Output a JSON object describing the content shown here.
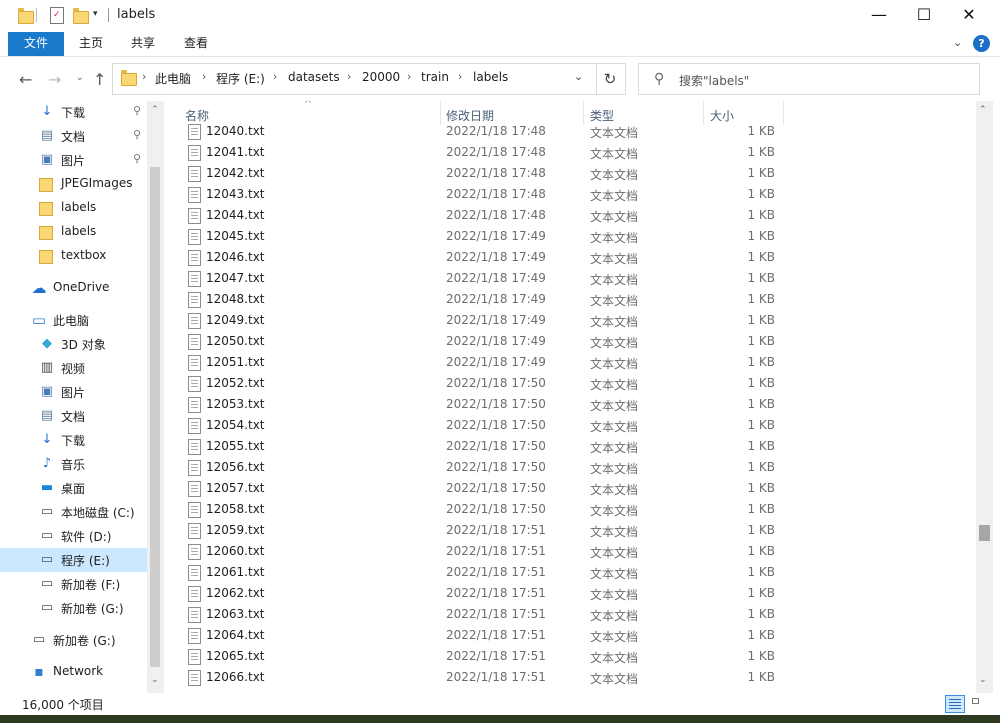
{
  "window": {
    "title": "labels",
    "controls": {
      "minimize": "—",
      "maximize": "☐",
      "close": "✕"
    }
  },
  "ribbon": {
    "tabs": [
      "文件",
      "主页",
      "共享",
      "查看"
    ],
    "help": "?"
  },
  "address": {
    "breadcrumbs": [
      "此电脑",
      "程序 (E:)",
      "datasets",
      "20000",
      "train",
      "labels"
    ]
  },
  "search": {
    "placeholder": "搜索\"labels\""
  },
  "sidebar": {
    "quick_access": [
      {
        "label": "下载",
        "icon": "download-icon",
        "pinned": true
      },
      {
        "label": "文档",
        "icon": "document-icon",
        "pinned": true
      },
      {
        "label": "图片",
        "icon": "pictures-icon",
        "pinned": true
      },
      {
        "label": "JPEGImages",
        "icon": "folder-icon",
        "pinned": false
      },
      {
        "label": "labels",
        "icon": "folder-icon",
        "pinned": false
      },
      {
        "label": "labels",
        "icon": "folder-icon",
        "pinned": false
      },
      {
        "label": "textbox",
        "icon": "folder-icon",
        "pinned": false
      }
    ],
    "onedrive": "OneDrive",
    "this_pc": "此电脑",
    "pc_items": [
      {
        "label": "3D 对象",
        "icon": "3d-objects-icon"
      },
      {
        "label": "视频",
        "icon": "video-icon"
      },
      {
        "label": "图片",
        "icon": "pictures-icon"
      },
      {
        "label": "文档",
        "icon": "document-icon"
      },
      {
        "label": "下载",
        "icon": "download-icon"
      },
      {
        "label": "音乐",
        "icon": "music-icon"
      },
      {
        "label": "桌面",
        "icon": "desktop-icon"
      },
      {
        "label": "本地磁盘 (C:)",
        "icon": "system-drive-icon"
      },
      {
        "label": "软件 (D:)",
        "icon": "drive-icon"
      },
      {
        "label": "程序 (E:)",
        "icon": "drive-icon",
        "selected": true
      },
      {
        "label": "新加卷 (F:)",
        "icon": "drive-icon"
      },
      {
        "label": "新加卷 (G:)",
        "icon": "drive-icon"
      }
    ],
    "removable": "新加卷 (G:)",
    "network": "Network"
  },
  "columns": {
    "name": "名称",
    "date": "修改日期",
    "type": "类型",
    "size": "大小"
  },
  "files": [
    {
      "name": "12040.txt",
      "date": "2022/1/18 17:48",
      "type": "文本文档",
      "size": "1 KB"
    },
    {
      "name": "12041.txt",
      "date": "2022/1/18 17:48",
      "type": "文本文档",
      "size": "1 KB"
    },
    {
      "name": "12042.txt",
      "date": "2022/1/18 17:48",
      "type": "文本文档",
      "size": "1 KB"
    },
    {
      "name": "12043.txt",
      "date": "2022/1/18 17:48",
      "type": "文本文档",
      "size": "1 KB"
    },
    {
      "name": "12044.txt",
      "date": "2022/1/18 17:48",
      "type": "文本文档",
      "size": "1 KB"
    },
    {
      "name": "12045.txt",
      "date": "2022/1/18 17:49",
      "type": "文本文档",
      "size": "1 KB"
    },
    {
      "name": "12046.txt",
      "date": "2022/1/18 17:49",
      "type": "文本文档",
      "size": "1 KB"
    },
    {
      "name": "12047.txt",
      "date": "2022/1/18 17:49",
      "type": "文本文档",
      "size": "1 KB"
    },
    {
      "name": "12048.txt",
      "date": "2022/1/18 17:49",
      "type": "文本文档",
      "size": "1 KB"
    },
    {
      "name": "12049.txt",
      "date": "2022/1/18 17:49",
      "type": "文本文档",
      "size": "1 KB"
    },
    {
      "name": "12050.txt",
      "date": "2022/1/18 17:49",
      "type": "文本文档",
      "size": "1 KB"
    },
    {
      "name": "12051.txt",
      "date": "2022/1/18 17:49",
      "type": "文本文档",
      "size": "1 KB"
    },
    {
      "name": "12052.txt",
      "date": "2022/1/18 17:50",
      "type": "文本文档",
      "size": "1 KB"
    },
    {
      "name": "12053.txt",
      "date": "2022/1/18 17:50",
      "type": "文本文档",
      "size": "1 KB"
    },
    {
      "name": "12054.txt",
      "date": "2022/1/18 17:50",
      "type": "文本文档",
      "size": "1 KB"
    },
    {
      "name": "12055.txt",
      "date": "2022/1/18 17:50",
      "type": "文本文档",
      "size": "1 KB"
    },
    {
      "name": "12056.txt",
      "date": "2022/1/18 17:50",
      "type": "文本文档",
      "size": "1 KB"
    },
    {
      "name": "12057.txt",
      "date": "2022/1/18 17:50",
      "type": "文本文档",
      "size": "1 KB"
    },
    {
      "name": "12058.txt",
      "date": "2022/1/18 17:50",
      "type": "文本文档",
      "size": "1 KB"
    },
    {
      "name": "12059.txt",
      "date": "2022/1/18 17:51",
      "type": "文本文档",
      "size": "1 KB"
    },
    {
      "name": "12060.txt",
      "date": "2022/1/18 17:51",
      "type": "文本文档",
      "size": "1 KB"
    },
    {
      "name": "12061.txt",
      "date": "2022/1/18 17:51",
      "type": "文本文档",
      "size": "1 KB"
    },
    {
      "name": "12062.txt",
      "date": "2022/1/18 17:51",
      "type": "文本文档",
      "size": "1 KB"
    },
    {
      "name": "12063.txt",
      "date": "2022/1/18 17:51",
      "type": "文本文档",
      "size": "1 KB"
    },
    {
      "name": "12064.txt",
      "date": "2022/1/18 17:51",
      "type": "文本文档",
      "size": "1 KB"
    },
    {
      "name": "12065.txt",
      "date": "2022/1/18 17:51",
      "type": "文本文档",
      "size": "1 KB"
    },
    {
      "name": "12066.txt",
      "date": "2022/1/18 17:51",
      "type": "文本文档",
      "size": "1 KB"
    }
  ],
  "status": {
    "item_count": "16,000 个项目"
  },
  "colors": {
    "accent": "#1979ca",
    "selection": "#cce8ff",
    "folder": "#f8d775"
  }
}
